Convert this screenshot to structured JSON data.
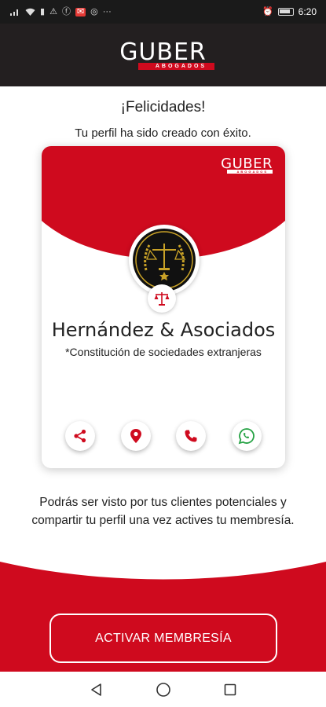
{
  "status_bar": {
    "time": "6:20",
    "more": "···"
  },
  "brand": {
    "name": "GUBER",
    "tagline": "ABOGADOS",
    "primary_color": "#cf0a1e",
    "header_bg": "#231f20"
  },
  "congrats": {
    "title": "¡Felicidades!",
    "subtitle": "Tu perfil ha sido creado con éxito."
  },
  "card": {
    "firm_name": "Hernández & Asociados",
    "specialty": "*Constitución de sociedades extranjeras",
    "actions": [
      {
        "name": "share",
        "icon": "share-icon"
      },
      {
        "name": "location",
        "icon": "location-pin-icon"
      },
      {
        "name": "phone",
        "icon": "phone-icon"
      },
      {
        "name": "whatsapp",
        "icon": "whatsapp-icon"
      }
    ]
  },
  "info": {
    "text": "Podrás ser visto por tus clientes potenciales y compartir tu perfil una vez actives tu membresía."
  },
  "cta": {
    "label": "ACTIVAR MEMBRESÍA"
  },
  "navbar": {
    "back": "back-icon",
    "home": "home-icon",
    "recents": "recents-icon"
  }
}
